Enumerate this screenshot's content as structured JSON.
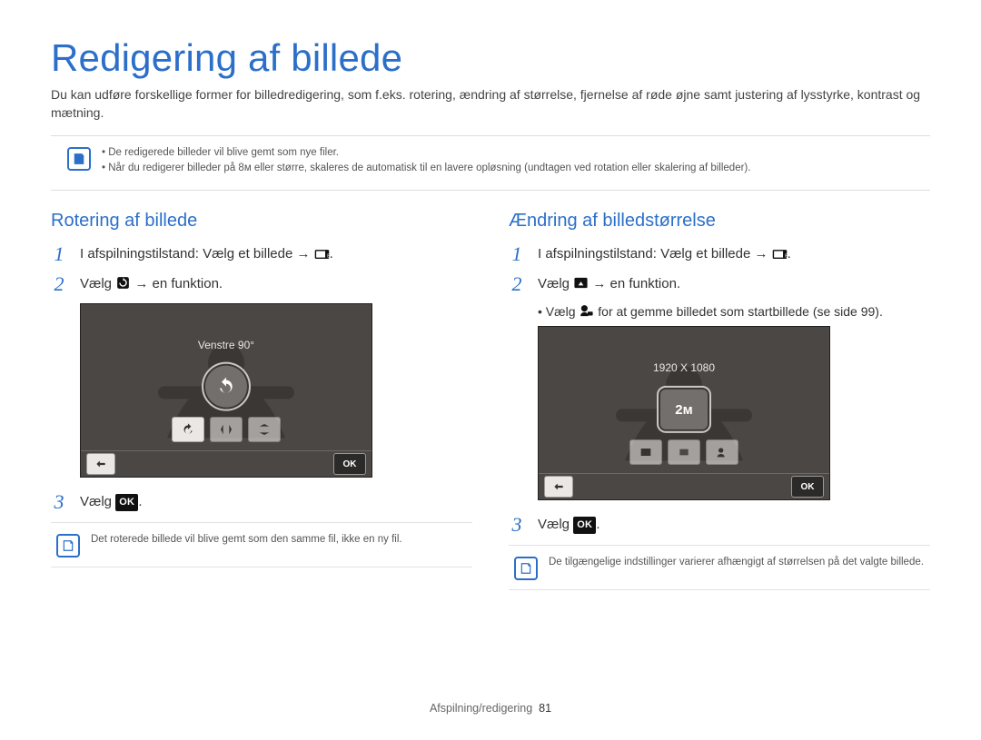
{
  "title": "Redigering af billede",
  "intro": "Du kan udføre forskellige former for billedredigering, som f.eks. rotering, ændring af størrelse, fjernelse af røde øjne samt justering af lysstyrke, kontrast og mætning.",
  "top_note": {
    "items": [
      "De redigerede billeder vil blive gemt som nye filer.",
      "Når du redigerer billeder på 8ᴍ eller større, skaleres de automatisk til en lavere opløsning (undtagen ved rotation eller skalering af billeder)."
    ]
  },
  "left": {
    "heading": "Rotering af billede",
    "step1": "I afspilningstilstand: Vælg et billede →",
    "step2_pre": "Vælg",
    "step2_post": "→ en funktion.",
    "device_label": "Venstre 90°",
    "step3": "Vælg",
    "note": "Det roterede billede vil blive gemt som den samme fil, ikke en ny fil."
  },
  "right": {
    "heading": "Ændring af billedstørrelse",
    "step1": "I afspilningstilstand: Vælg et billede →",
    "step2_pre": "Vælg",
    "step2_post": "→ en funktion.",
    "bullet_pre": "Vælg",
    "bullet_post": "for at gemme billedet som startbillede (se side 99).",
    "device_label": "1920 X 1080",
    "center_badge": "2ᴍ",
    "step3": "Vælg",
    "note": "De tilgængelige indstillinger varierer afhængigt af størrelsen på det valgte billede."
  },
  "ok_label": "OK",
  "footer_section": "Afspilning/redigering",
  "footer_page": "81"
}
